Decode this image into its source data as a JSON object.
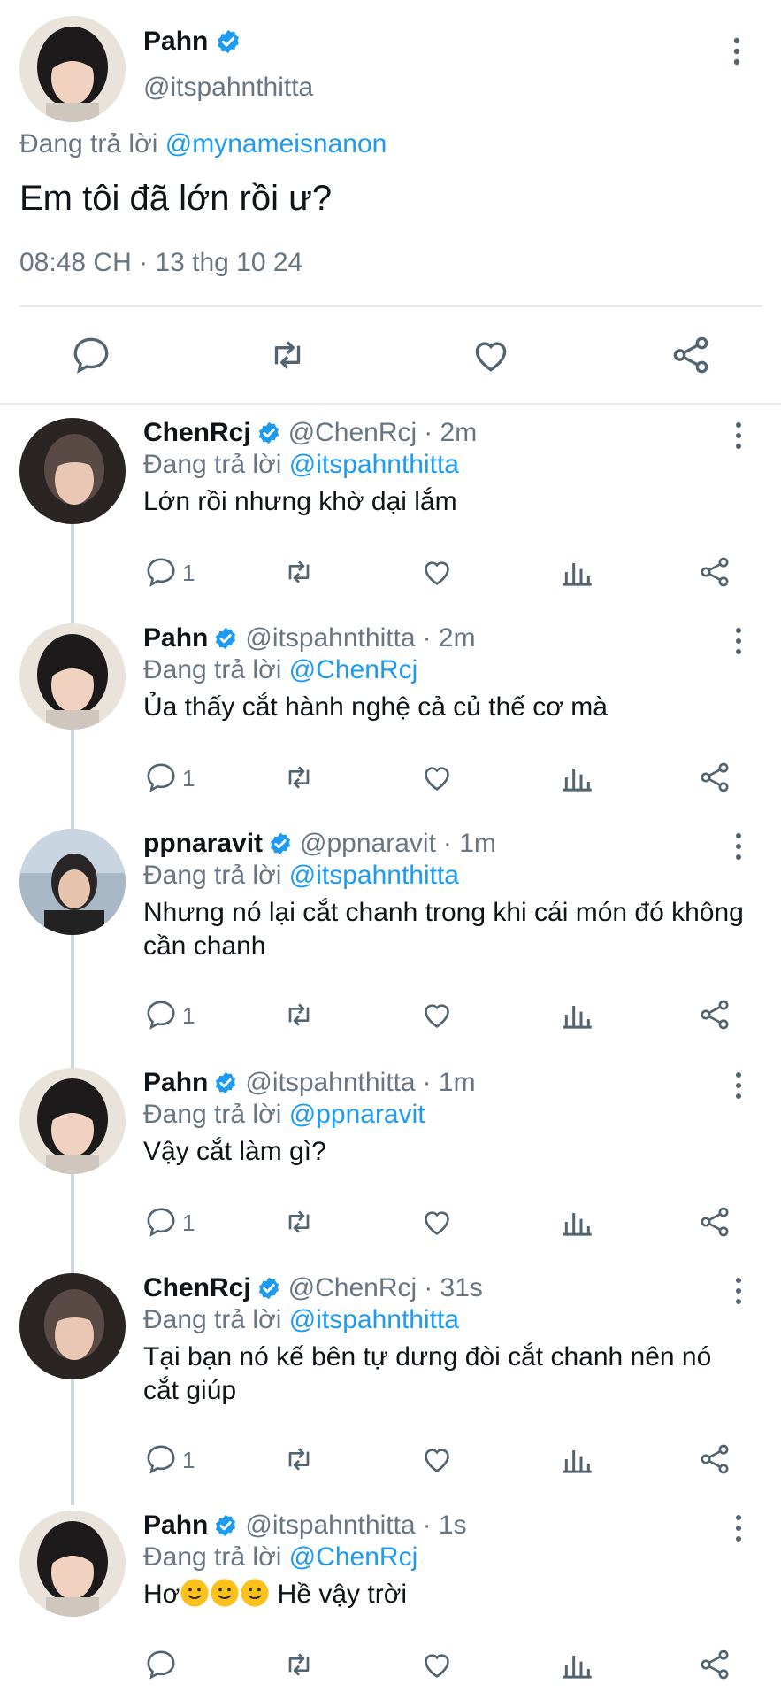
{
  "colors": {
    "accent": "#1d9bf0",
    "text": "#0f1419",
    "muted": "#687684",
    "divider": "#e6ecf0"
  },
  "main_tweet": {
    "name": "Pahn",
    "handle": "@itspahnthitta",
    "replying_prefix": "Đang trả lời",
    "replying_to": "@mynameisnanon",
    "text": "Em tôi đã lớn rồi ư?",
    "timestamp": "08:48 CH · 13 thg 10 24",
    "icons": [
      "comment-icon",
      "retweet-icon",
      "like-icon",
      "share-icon"
    ]
  },
  "replies": [
    {
      "name": "ChenRcj",
      "handle": "@ChenRcj",
      "time": "· 2m",
      "replying_prefix": "Đang trả lời",
      "replying_to": "@itspahnthitta",
      "text": "Lớn rồi nhưng khờ dại lắm",
      "reply_count": "1"
    },
    {
      "name": "Pahn",
      "handle": "@itspahnthitta",
      "time": "· 2m",
      "replying_prefix": "Đang trả lời",
      "replying_to": "@ChenRcj",
      "text": "Ủa thấy cắt hành nghệ cả củ thế cơ mà",
      "reply_count": "1"
    },
    {
      "name": "ppnaravit",
      "handle": "@ppnaravit",
      "time": "· 1m",
      "replying_prefix": "Đang trả lời",
      "replying_to": "@itspahnthitta",
      "text": "Nhưng nó lại cắt chanh trong khi cái món đó không cần chanh",
      "reply_count": "1"
    },
    {
      "name": "Pahn",
      "handle": "@itspahnthitta",
      "time": "· 1m",
      "replying_prefix": "Đang trả lời",
      "replying_to": "@ppnaravit",
      "text": "Vậy cắt làm gì?",
      "reply_count": "1"
    },
    {
      "name": "ChenRcj",
      "handle": "@ChenRcj",
      "time": "· 31s",
      "replying_prefix": "Đang trả lời",
      "replying_to": "@itspahnthitta",
      "text": "Tại bạn nó kế bên tự dưng đòi cắt chanh nên nó cắt giúp",
      "reply_count": "1"
    },
    {
      "name": "Pahn",
      "handle": "@itspahnthitta",
      "time": "· 1s",
      "replying_prefix": "Đang trả lời",
      "replying_to": "@ChenRcj",
      "text_prefix": "Hơ",
      "text_suffix": " Hề vậy trời",
      "emoji": "slightly-smiling-face-icon",
      "reply_count": ""
    }
  ]
}
